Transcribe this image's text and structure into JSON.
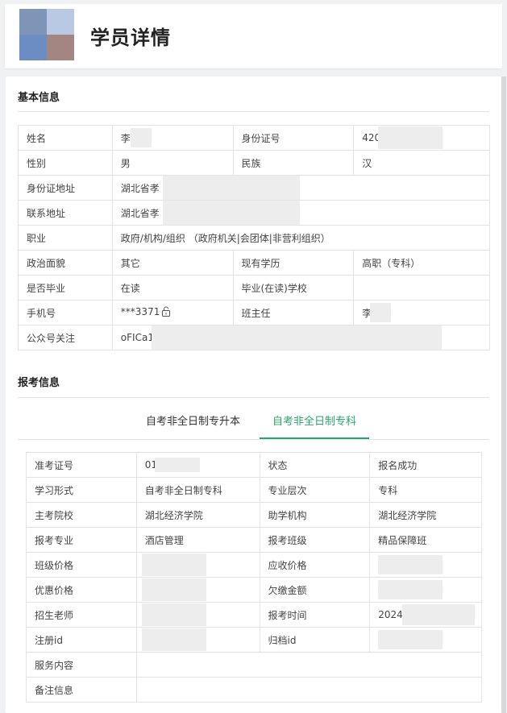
{
  "header": {
    "title": "学员详情"
  },
  "basic": {
    "section_title": "基本信息",
    "rows": [
      [
        "姓名",
        "李",
        "身份证号",
        "420"
      ],
      [
        "性别",
        "男",
        "民族",
        "汉"
      ],
      [
        "身份证地址",
        "湖北省孝",
        "",
        ""
      ],
      [
        "联系地址",
        "湖北省孝",
        "",
        ""
      ],
      [
        "职业",
        "政府/机构/组织 （政府机关|会团体|非营利组织）",
        "",
        ""
      ],
      [
        "政治面貌",
        "其它",
        "现有学历",
        "高职（专科）"
      ],
      [
        "是否毕业",
        "在读",
        "毕业(在读)学校",
        ""
      ],
      [
        "手机号",
        "***3371",
        "班主任",
        "李"
      ],
      [
        "公众号关注",
        "oFICa1",
        "",
        ""
      ]
    ]
  },
  "exam": {
    "section_title": "报考信息",
    "tabs": [
      "自考非全日制专升本",
      "自考非全日制专科"
    ],
    "active_tab": 1,
    "rows": [
      [
        "准考证号",
        "01",
        "状态",
        "报名成功"
      ],
      [
        "学习形式",
        "自考非全日制专科",
        "专业层次",
        "专科"
      ],
      [
        "主考院校",
        "湖北经济学院",
        "助学机构",
        "湖北经济学院"
      ],
      [
        "报考专业",
        "酒店管理",
        "报考班级",
        "精品保障班"
      ],
      [
        "班级价格",
        "",
        "应收价格",
        ""
      ],
      [
        "优惠价格",
        "",
        "欠缴金额",
        ""
      ],
      [
        "招生老师",
        "",
        "报考时间",
        "2024-"
      ],
      [
        "注册id",
        "",
        "归档id",
        ""
      ],
      [
        "服务内容",
        "",
        "",
        ""
      ],
      [
        "备注信息",
        "",
        "",
        ""
      ]
    ]
  },
  "icons": {
    "lock": "lock-icon"
  },
  "colors": {
    "accent": "#2aa56d"
  }
}
